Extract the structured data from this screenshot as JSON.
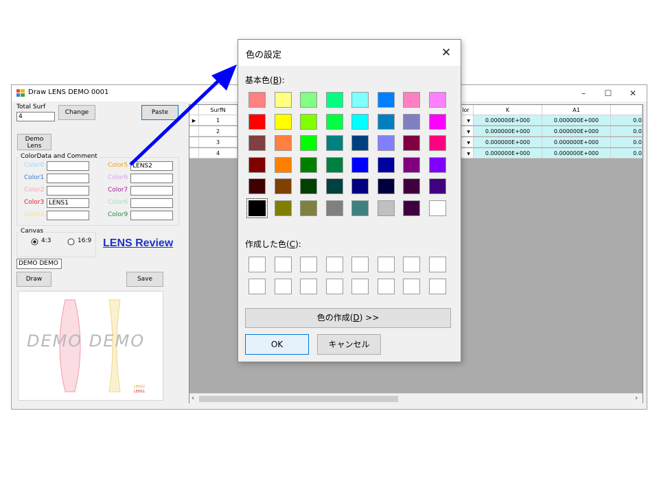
{
  "main_window": {
    "title": "Draw LENS DEMO 0001",
    "minimize_label": "–",
    "maximize_label": "☐",
    "close_label": "✕"
  },
  "left_panel": {
    "total_surf_label": "Total Surf",
    "total_surf_value": "4",
    "change_label": "Change",
    "paste_label": "Paste",
    "demo_lens_label_1": "Demo",
    "demo_lens_label_2": "Lens",
    "color_group_label": "ColorData and Comment",
    "colors": [
      {
        "label": "Color0",
        "value": "",
        "color": "#9fd3f5"
      },
      {
        "label": "Color1",
        "value": "",
        "color": "#3c78c8"
      },
      {
        "label": "Color2",
        "value": "",
        "color": "#f3a6b4"
      },
      {
        "label": "Color3",
        "value": "LENS1",
        "color": "#e0202c"
      },
      {
        "label": "Color4",
        "value": "",
        "color": "#f2e38a"
      },
      {
        "label": "Color5",
        "value": "LENS2",
        "color": "#e9a21a"
      },
      {
        "label": "Color6",
        "value": "",
        "color": "#d6a7e0"
      },
      {
        "label": "Color7",
        "value": "",
        "color": "#a0209b"
      },
      {
        "label": "Color8",
        "value": "",
        "color": "#9fe3b5"
      },
      {
        "label": "Color9",
        "value": "",
        "color": "#1f8c3a"
      }
    ],
    "canvas_label": "Canvas",
    "radio_43": "4:3",
    "radio_169": "16:9",
    "lens_review_link": "LENS Review",
    "comment_value": "DEMO DEMO",
    "draw_label": "Draw",
    "save_label": "Save",
    "preview_watermark": "DEMO DEMO",
    "preview_legend_1": "LENS2",
    "preview_legend_2": "LENS1"
  },
  "grid": {
    "col_surfn": "SurfN",
    "col_color": "lor",
    "col_k": "K",
    "col_a1": "A1",
    "rows": [
      {
        "num": "1",
        "k": "0.000000E+000",
        "a1": "0.000000E+000",
        "tail": "0.0"
      },
      {
        "num": "2",
        "k": "0.000000E+000",
        "a1": "0.000000E+000",
        "tail": "0.0"
      },
      {
        "num": "3",
        "k": "0.000000E+000",
        "a1": "0.000000E+000",
        "tail": "0.0"
      },
      {
        "num": "4",
        "k": "0.000000E+000",
        "a1": "0.000000E+000",
        "tail": "0.0"
      }
    ]
  },
  "dialog": {
    "title": "色の設定",
    "close_label": "✕",
    "basic_colors_label": "基本色(",
    "basic_colors_key": "B",
    "basic_colors_suffix": "):",
    "basic_colors": [
      "#ff8080",
      "#ffff80",
      "#80ff80",
      "#00ff80",
      "#80ffff",
      "#0080ff",
      "#ff80c0",
      "#ff80ff",
      "#ff0000",
      "#ffff00",
      "#80ff00",
      "#00ff40",
      "#00ffff",
      "#0080c0",
      "#8080c0",
      "#ff00ff",
      "#804040",
      "#ff8040",
      "#00ff00",
      "#008080",
      "#004080",
      "#8080ff",
      "#800040",
      "#ff0080",
      "#800000",
      "#ff8000",
      "#008000",
      "#008040",
      "#0000ff",
      "#0000a0",
      "#800080",
      "#8000ff",
      "#400000",
      "#804000",
      "#004000",
      "#004040",
      "#000080",
      "#000040",
      "#400040",
      "#400080",
      "#000000",
      "#808000",
      "#808040",
      "#808080",
      "#408080",
      "#c0c0c0",
      "#400040",
      "#ffffff"
    ],
    "custom_colors_label": "作成した色(",
    "custom_colors_key": "C",
    "custom_colors_suffix": "):",
    "define_label": "色の作成(",
    "define_key": "D",
    "define_suffix": ") >>",
    "ok_label": "OK",
    "cancel_label": "キャンセル"
  },
  "annotation": {
    "arrow_color": "#0000ff"
  }
}
